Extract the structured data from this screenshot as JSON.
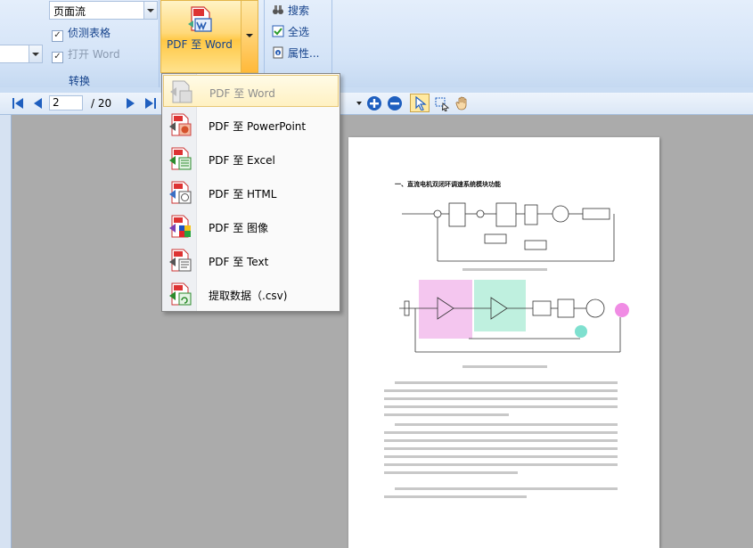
{
  "ribbon": {
    "layout_combo": {
      "value": "页面流"
    },
    "detect_table": {
      "label": "侦测表格",
      "checked": true
    },
    "open_word": {
      "label": "打开 Word",
      "checked": true
    },
    "group_label": "转换",
    "convert_button": {
      "label": "PDF 至 Word"
    },
    "search": {
      "label": "搜索"
    },
    "select_all": {
      "label": "全选"
    },
    "properties": {
      "label": "属性..."
    }
  },
  "toolbar": {
    "current_page": "2",
    "page_count": "/ 20"
  },
  "menu": {
    "items": [
      {
        "label": "PDF 至 Word",
        "disabled": true,
        "icon": "word-convert-icon"
      },
      {
        "label": "PDF 至 PowerPoint",
        "disabled": false,
        "icon": "powerpoint-convert-icon"
      },
      {
        "label": "PDF 至 Excel",
        "disabled": false,
        "icon": "excel-convert-icon"
      },
      {
        "label": "PDF 至 HTML",
        "disabled": false,
        "icon": "html-convert-icon"
      },
      {
        "label": "PDF 至 图像",
        "disabled": false,
        "icon": "image-convert-icon"
      },
      {
        "label": "PDF 至 Text",
        "disabled": false,
        "icon": "text-convert-icon"
      },
      {
        "label": "提取数据（.csv)",
        "disabled": false,
        "icon": "csv-extract-icon"
      }
    ]
  },
  "document": {
    "heading": "一、直流电机双闭环调速系统模块功能"
  },
  "colors": {
    "ribbon_bg": "#d3e3f7",
    "highlight": "#ffd97a",
    "workspace": "#ababab",
    "accent_blue": "#1f5fbf"
  }
}
